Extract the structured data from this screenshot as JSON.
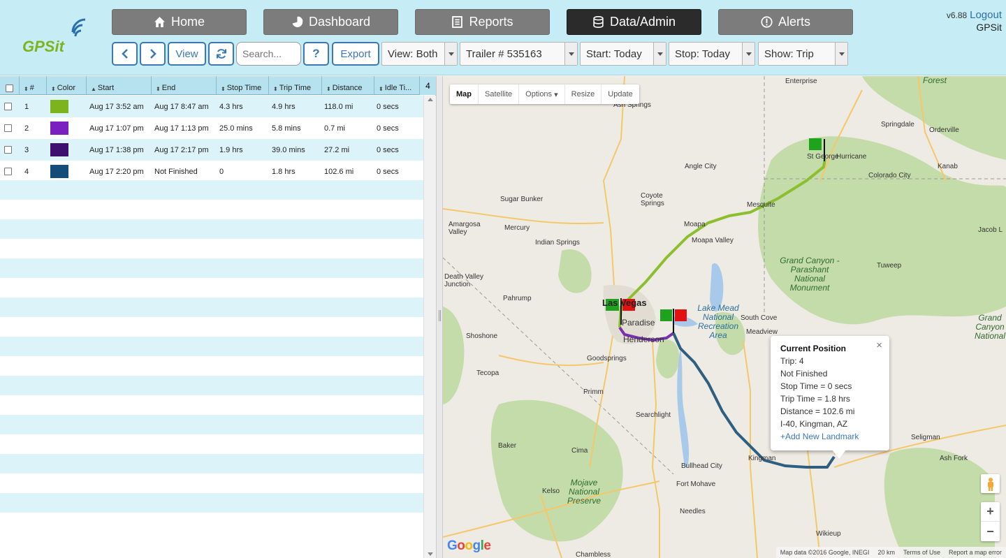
{
  "header": {
    "logo_text": "GPSit",
    "version": "v6.88",
    "logout": "Logout",
    "company": "GPSit",
    "nav": [
      {
        "label": "Home",
        "icon": "home-icon",
        "active": false
      },
      {
        "label": "Dashboard",
        "icon": "pie-chart-icon",
        "active": false
      },
      {
        "label": "Reports",
        "icon": "report-icon",
        "active": false
      },
      {
        "label": "Data/Admin",
        "icon": "database-icon",
        "active": true
      },
      {
        "label": "Alerts",
        "icon": "alert-icon",
        "active": false
      }
    ]
  },
  "toolbar": {
    "prev_icon": "chevron-left-icon",
    "next_icon": "chevron-right-icon",
    "view_label": "View",
    "refresh_icon": "refresh-icon",
    "search_placeholder": "Search...",
    "help_label": "?",
    "export_label": "Export",
    "view_select": "View: Both",
    "trailer_select": "Trailer # 535163",
    "start_select": "Start: Today",
    "stop_select": "Stop: Today",
    "show_select": "Show: Trip"
  },
  "table": {
    "column_count": "4",
    "headers": [
      "#",
      "Color",
      "Start",
      "End",
      "Stop Time",
      "Trip Time",
      "Distance",
      "Idle Ti..."
    ],
    "rows": [
      {
        "num": "1",
        "color": "#7db41e",
        "start": "Aug 17 3:52 am",
        "end": "Aug 17 8:47 am",
        "stop_time": "4.3 hrs",
        "trip_time": "4.9 hrs",
        "distance": "118.0 mi",
        "idle_time": "0 secs"
      },
      {
        "num": "2",
        "color": "#7a1fc0",
        "start": "Aug 17 1:07 pm",
        "end": "Aug 17 1:13 pm",
        "stop_time": "25.0 mins",
        "trip_time": "5.8 mins",
        "distance": "0.7 mi",
        "idle_time": "0 secs"
      },
      {
        "num": "3",
        "color": "#3e0f6e",
        "start": "Aug 17 1:38 pm",
        "end": "Aug 17 2:17 pm",
        "stop_time": "1.9 hrs",
        "trip_time": "39.0 mins",
        "distance": "27.2 mi",
        "idle_time": "0 secs"
      },
      {
        "num": "4",
        "color": "#144d7a",
        "start": "Aug 17 2:20 pm",
        "end": "Not Finished",
        "stop_time": "0",
        "trip_time": "1.8 hrs",
        "distance": "102.6 mi",
        "idle_time": "0 secs"
      }
    ]
  },
  "map": {
    "type_controls": [
      "Map",
      "Satellite",
      "Options",
      "Resize",
      "Update"
    ],
    "route_colors": {
      "trip1": "#8cbf2e",
      "trip2": "#7a2fb0",
      "trip4": "#2f5f80"
    },
    "labels": {
      "enterprise": "Enterprise",
      "forest": "Forest",
      "ash_springs": "Ash Springs",
      "angle_city": "Angle City",
      "springdale": "Springdale",
      "orderville": "Orderville",
      "st_george": "St George",
      "hurricane": "Hurricane",
      "kanab": "Kanab",
      "colorado_city": "Colorado City",
      "coyote_springs": "Coyote Springs",
      "sugar_bunker": "Sugar Bunker",
      "amargosa_valley": "Amargosa Valley",
      "mercury": "Mercury",
      "indian_springs": "Indian Springs",
      "mesquite": "Mesquite",
      "moapa": "Moapa",
      "moapa_valley": "Moapa Valley",
      "jacob_lake": "Jacob L",
      "grand_canyon": "Grand Canyon - Parashant National Monument",
      "tuweep": "Tuweep",
      "death_valley": "Death Valley Junction",
      "pahrump": "Pahrump",
      "las_vegas": "Las Vegas",
      "paradise": "Paradise",
      "henderson": "Henderson",
      "lake_mead": "Lake Mead National Recreation Area",
      "south_cove": "South Cove",
      "meadview": "Meadview",
      "shoshone": "Shoshone",
      "goodsprings": "Goodsprings",
      "tecopa": "Tecopa",
      "primm": "Primm",
      "searchlight": "Searchlight",
      "baker": "Baker",
      "cima": "Cima",
      "kingman": "Kingman",
      "seligman": "Seligman",
      "ash_fork": "Ash Fork",
      "grand_canyon_np": "Grand Canyon National",
      "bullhead_city": "Bullhead City",
      "fort_mohave": "Fort Mohave",
      "mojave": "Mojave National Preserve",
      "kelso": "Kelso",
      "needles": "Needles",
      "wikieup": "Wikieup",
      "chambless": "Chambless"
    },
    "popup": {
      "title": "Current Position",
      "trip": "Trip: 4",
      "status": "Not Finished",
      "stop_time": "Stop Time = 0 secs",
      "trip_time": "Trip Time = 1.8 hrs",
      "distance": "Distance = 102.6 mi",
      "location": "I-40, Kingman, AZ",
      "add_landmark": "+Add New Landmark",
      "close": "×"
    },
    "zoom_in": "+",
    "zoom_out": "−",
    "google": "Google",
    "attribution": [
      "Map data ©2016 Google, INEGI",
      "20 km",
      "Terms of Use",
      "Report a map error"
    ]
  }
}
